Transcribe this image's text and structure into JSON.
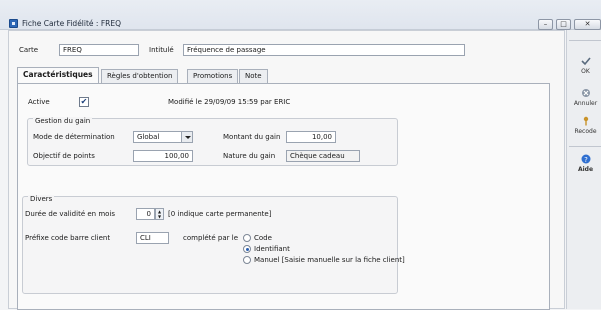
{
  "window": {
    "title": "Fiche Carte Fidélité : FREQ"
  },
  "header": {
    "carte_label": "Carte",
    "carte_value": "FREQ",
    "intitule_label": "Intitulé",
    "intitule_value": "Fréquence de passage"
  },
  "tabs": [
    {
      "label": "Caractéristiques",
      "active": true
    },
    {
      "label": "Règles d'obtention",
      "active": false
    },
    {
      "label": "Promotions",
      "active": false
    },
    {
      "label": "Note",
      "active": false
    }
  ],
  "caracteristiques": {
    "active_label": "Active",
    "active_checked": true,
    "modified_text": "Modifié le 29/09/09 15:59 par ERIC",
    "gestion_gain": {
      "title": "Gestion du gain",
      "mode_label": "Mode de détermination",
      "mode_value": "Global",
      "montant_label": "Montant du gain",
      "montant_value": "10,00",
      "objectif_label": "Objectif de points",
      "objectif_value": "100,00",
      "nature_label": "Nature du gain",
      "nature_value": "Chèque cadeau"
    },
    "divers": {
      "title": "Divers",
      "duree_label": "Durée de validité en mois",
      "duree_value": "0",
      "duree_hint": "[0 indique carte permanente]",
      "prefixe_label": "Préfixe code barre client",
      "prefixe_value": "CLI",
      "complete_label": "complété par le",
      "options": [
        {
          "label": "Code",
          "selected": false
        },
        {
          "label": "Identifiant",
          "selected": true
        },
        {
          "label": "Manuel  [Saisie manuelle sur la fiche client]",
          "selected": false
        }
      ]
    }
  },
  "sidebar": {
    "ok": "OK",
    "annuler": "Annuler",
    "recode": "Recode",
    "aide": "Aide"
  },
  "colors": {
    "accent": "#2b5fb0",
    "window_bg": "#f3f4f6",
    "panel_bg": "#fafafa"
  }
}
